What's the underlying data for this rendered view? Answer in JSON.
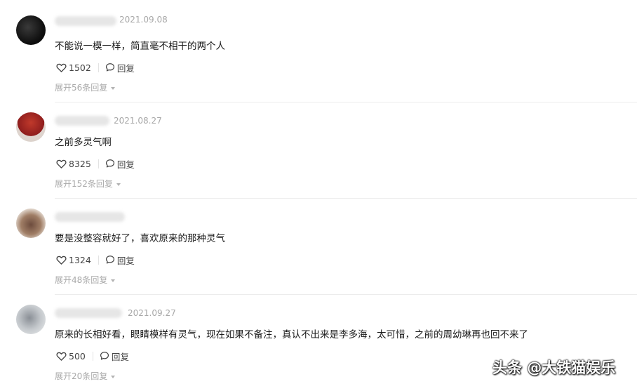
{
  "comments": [
    {
      "date": "2021.09.08",
      "text": "不能说一模一样，简直毫不相干的两个人",
      "likes": "1502",
      "reply_label": "回复",
      "expand_label": "展开56条回复"
    },
    {
      "date": "2021.08.27",
      "text": "之前多灵气啊",
      "likes": "8325",
      "reply_label": "回复",
      "expand_label": "展开152条回复"
    },
    {
      "date": "",
      "text": "要是没整容就好了，喜欢原来的那种灵气",
      "likes": "1324",
      "reply_label": "回复",
      "expand_label": "展开48条回复"
    },
    {
      "date": "2021.09.27",
      "text": "原来的长相好看，眼睛模样有灵气，现在如果不备注，真认不出来是李多海，太可惜，之前的周幼琳再也回不来了",
      "likes": "500",
      "reply_label": "回复",
      "expand_label": "展开20条回复"
    }
  ],
  "watermark": "头条 @大铁猫娱乐",
  "icons": {
    "like": "heart-icon",
    "reply": "comment-bubble-icon",
    "expand": "caret-down-icon"
  },
  "colors": {
    "text": "#1a1a1a",
    "meta": "#a8a8a8",
    "divider": "#ececec"
  }
}
